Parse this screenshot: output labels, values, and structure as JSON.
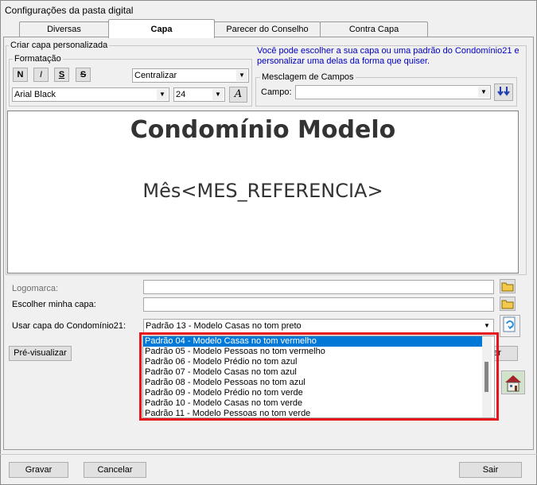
{
  "window": {
    "title": "Configurações da pasta digital"
  },
  "tabs": [
    {
      "label": "Diversas"
    },
    {
      "label": "Capa"
    },
    {
      "label": "Parecer do Conselho"
    },
    {
      "label": "Contra Capa"
    }
  ],
  "criar_capa": {
    "legend": "Criar capa personalizada",
    "hint": "Você pode escolher a sua capa ou uma padrão do Condomínio21 e personalizar uma delas da forma que quiser.",
    "formatacao": {
      "legend": "Formatação",
      "bold": "N",
      "italic": "I",
      "underline": "S",
      "strike": "S",
      "align_value": "Centralizar",
      "font_value": "Arial Black",
      "size_value": "24",
      "font_button": "A"
    },
    "mesclagem": {
      "legend": "Mesclagem de Campos",
      "campo_label": "Campo:",
      "campo_value": ""
    }
  },
  "editor": {
    "heading": "Condomínio Modelo",
    "subheading": "Mês<MES_REFERENCIA>"
  },
  "form": {
    "logomarca_label": "Logomarca:",
    "logomarca_value": "",
    "minha_capa_label": "Escolher minha capa:",
    "minha_capa_value": "",
    "usar_capa_label": "Usar capa do Condomínio21:",
    "usar_capa_value": "Padrão 13 - Modelo Casas no tom preto",
    "dropdown_options": [
      "Padrão 04 - Modelo Casas no tom vermelho",
      "Padrão 05 - Modelo Pessoas no tom vermelho",
      "Padrão 06 - Modelo Prédio no tom azul",
      "Padrão 07 - Modelo Casas no tom azul",
      "Padrão 08 - Modelo Pessoas no tom azul",
      "Padrão 09 - Modelo Prédio no tom verde",
      "Padrão 10 - Modelo Casas no tom verde",
      "Padrão 11 - Modelo Pessoas no tom verde"
    ],
    "preview_button": "Pré-visualizar",
    "partial_button": "ar"
  },
  "footer": {
    "gravar": "Gravar",
    "cancelar": "Cancelar",
    "sair": "Sair"
  },
  "colors": {
    "highlight": "#0078d7",
    "hint_text": "#0000c0",
    "annotation_box": "#e8141c"
  }
}
